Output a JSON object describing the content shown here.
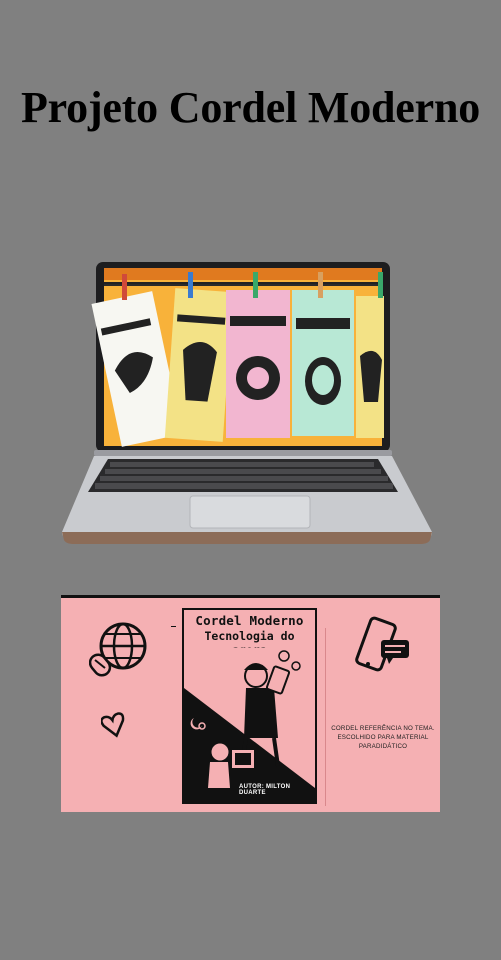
{
  "page": {
    "title": "Projeto Cordel Moderno",
    "background": "#808080"
  },
  "laptop_image": {
    "booklets": [
      {
        "title": "AL e o DRAGÃO",
        "color": "#ffffff"
      },
      {
        "title": "A DO CEARÁ",
        "color": "#f4e58a"
      },
      {
        "title": "RIMENTOS DE ZIRA",
        "color": "#f2b8d2"
      },
      {
        "title": "TÓRIA DA DONZELA TEODORA",
        "color": "#b9ead7"
      },
      {
        "title": "MAGE",
        "color": "#f4e58a"
      }
    ]
  },
  "banner": {
    "book_title": "Cordel Moderno",
    "book_subtitle": "Tecnologia do agora",
    "book_author": "AUTOR: MILTON DUARTE",
    "caption": "CORDEL REFERÊNCIA NO TEMA. ESCOLHIDO PARA MATERIAL PARADIDÁTICO",
    "background": "#f5b0b3"
  }
}
